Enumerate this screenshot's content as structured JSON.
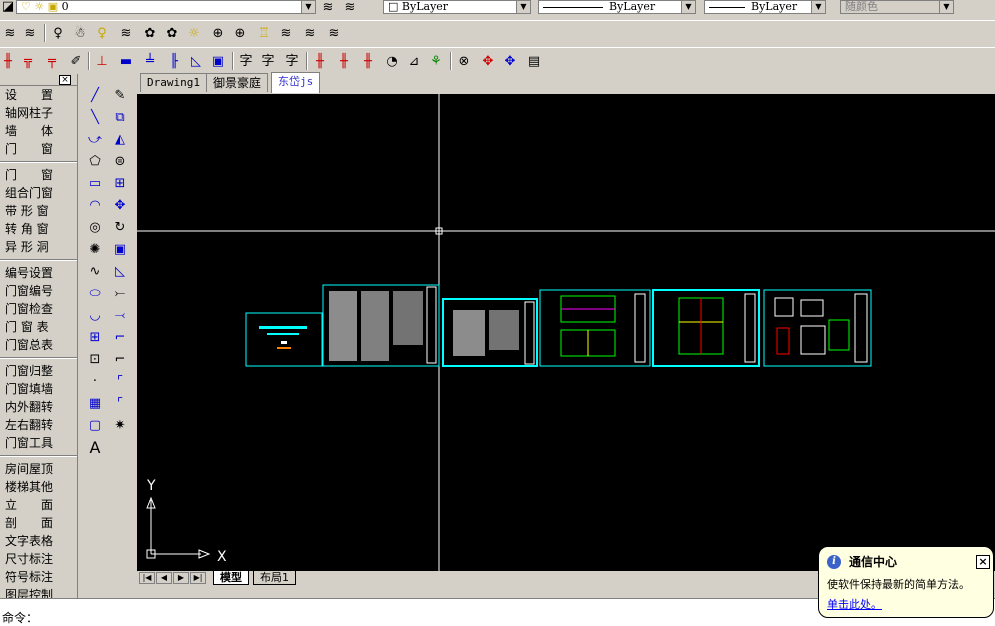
{
  "toolbar_top": {
    "layer_value": "0",
    "color_combo": "ByLayer",
    "linetype_combo": "ByLayer",
    "lineweight_combo": "ByLayer",
    "plotstyle_combo": "随颜色"
  },
  "toolbar_icons": {
    "row2": [
      "layer-manager-icon",
      "layer-state-icon",
      "bulb-icon",
      "freeze-icon",
      "light-icon",
      "lock-icon",
      "layer-isolate-icon",
      "layer-unisolate-icon",
      "layer-off-icon",
      "layer-walk-icon",
      "match-layer-icon",
      "layer-merge-icon"
    ],
    "row3": [
      "axis-icon",
      "column-icon",
      "wall-icon",
      "window-icon",
      "section-icon",
      "line-icon",
      "dim-icon",
      "stair-icon",
      "slope-icon",
      "fill-icon",
      "text-icon",
      "text2-icon",
      "text3-icon",
      "grid-icon",
      "grid2-icon",
      "grid3-icon",
      "rotate-icon",
      "align-icon",
      "zoom-icon",
      "pan-icon",
      "move-icon",
      "paste-icon"
    ]
  },
  "tianzheng_menu": {
    "close": "×",
    "groups": [
      [
        "设　　置",
        "轴网柱子",
        "墙　　体",
        "门　　窗"
      ],
      [
        "门　　窗",
        "组合门窗",
        "带 形 窗",
        "转 角 窗",
        "异 形 洞"
      ],
      [
        "编号设置",
        "门窗编号",
        "门窗检查",
        "门 窗 表",
        "门窗总表"
      ],
      [
        "门窗归整",
        "门窗填墙",
        "内外翻转",
        "左右翻转",
        "门窗工具"
      ],
      [
        "房间屋顶",
        "楼梯其他",
        "立　　面",
        "剖　　面",
        "文字表格",
        "尺寸标注",
        "符号标注",
        "图层控制"
      ]
    ]
  },
  "draw_tools": [
    "line-icon",
    "xline-icon",
    "pline-icon",
    "polygon-icon",
    "rectangle-icon",
    "arc-icon",
    "circle-icon",
    "revcloud-icon",
    "spline-icon",
    "ellipse-icon",
    "ellipse-arc-icon",
    "insert-block-icon",
    "make-block-icon",
    "point-icon",
    "hatch-icon",
    "region-icon",
    "mtext-icon"
  ],
  "draw_tool_last_label": "A",
  "modify_tools": [
    "erase-icon",
    "copy-icon",
    "mirror-icon",
    "offset-icon",
    "array-icon",
    "move-icon",
    "rotate-icon",
    "scale-icon",
    "stretch-icon",
    "trim-icon",
    "extend-icon",
    "break-point-icon",
    "break-icon",
    "chamfer-icon",
    "fillet-icon",
    "explode-icon"
  ],
  "drawing_tabs": [
    "Drawing1",
    "御景豪庭",
    "东岱js"
  ],
  "active_drawing_tab": 2,
  "axis": {
    "x": "X",
    "y": "Y"
  },
  "layout_tabs": [
    "模型",
    "布局1"
  ],
  "nav_buttons": [
    "|◀",
    "◀",
    "▶",
    "▶|"
  ],
  "command": {
    "prompt": "命令："
  },
  "balloon": {
    "title": "通信中心",
    "text": "使软件保持最新的简单方法。",
    "link": "单击此处。",
    "close": "×"
  },
  "colors": {
    "canvas": "#000000",
    "sheet_border": "#00ffff",
    "crosshair": "#ffffff",
    "active_tab_text": "#3333cc"
  }
}
